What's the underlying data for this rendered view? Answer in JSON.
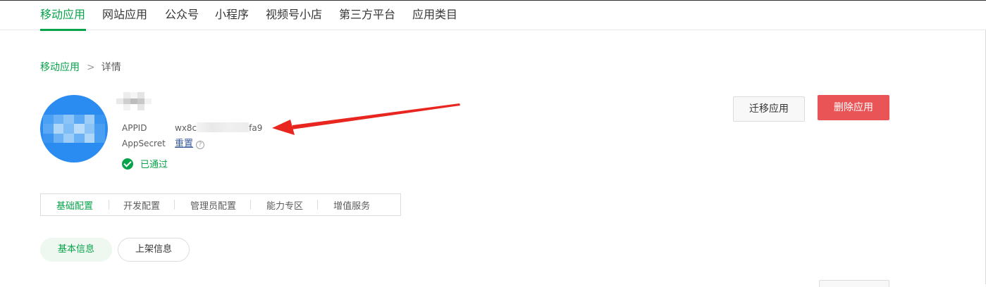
{
  "topnav": {
    "tabs": [
      {
        "label": "移动应用",
        "active": true
      },
      {
        "label": "网站应用",
        "active": false
      },
      {
        "label": "公众号",
        "active": false
      },
      {
        "label": "小程序",
        "active": false
      },
      {
        "label": "视频号小店",
        "active": false
      },
      {
        "label": "第三方平台",
        "active": false
      },
      {
        "label": "应用类目",
        "active": false
      }
    ]
  },
  "breadcrumb": {
    "parent": "移动应用",
    "separator": ">",
    "current": "详情"
  },
  "app": {
    "appid_label": "APPID",
    "appid_prefix": "wx8c",
    "appid_suffix": "fa9",
    "appsecret_label": "AppSecret",
    "appsecret_action": "重置",
    "help_glyph": "?",
    "status": "已通过"
  },
  "actions": {
    "migrate": "迁移应用",
    "delete": "删除应用"
  },
  "subtabs": [
    {
      "label": "基础配置",
      "active": true
    },
    {
      "label": "开发配置",
      "active": false
    },
    {
      "label": "管理员配置",
      "active": false
    },
    {
      "label": "能力专区",
      "active": false
    },
    {
      "label": "增值服务",
      "active": false
    }
  ],
  "pills": [
    {
      "label": "基本信息",
      "active": true
    },
    {
      "label": "上架信息",
      "active": false
    }
  ],
  "colors": {
    "accent": "#07a34a",
    "danger": "#e95556",
    "avatar": "#2a8cf0",
    "annotation_arrow": "#e8251f"
  }
}
